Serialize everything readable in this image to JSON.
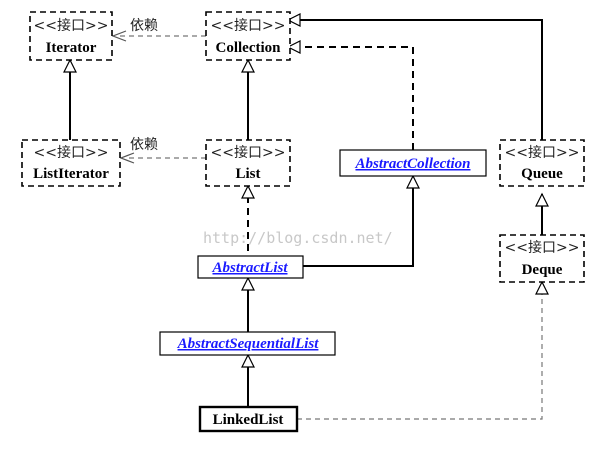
{
  "diagram": {
    "stereotype": "<<接口>>",
    "dependency_label": "依赖",
    "watermark": "http://blog.csdn.net/",
    "nodes": {
      "iterator": "Iterator",
      "collection": "Collection",
      "list_iterator": "ListIterator",
      "list": "List",
      "abstract_collection": "AbstractCollection",
      "queue": "Queue",
      "deque": "Deque",
      "abstract_list": "AbstractList",
      "abstract_sequential_list": "AbstractSequentialList",
      "linked_list": "LinkedList"
    }
  }
}
